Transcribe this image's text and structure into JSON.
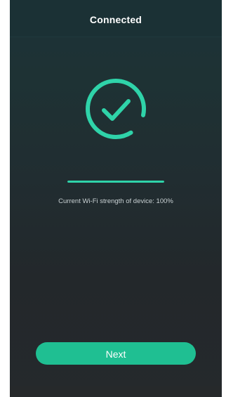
{
  "header": {
    "title": "Connected"
  },
  "status": {
    "icon": "check-circle-icon",
    "wifi_strength_text": "Current Wi-Fi strength of device: 100%",
    "progress": 1.0
  },
  "actions": {
    "next_label": "Next"
  },
  "colors": {
    "accent": "#2fd3a9",
    "button": "#1fbf92",
    "background_top": "#1c3338",
    "background_bottom": "#25292c"
  }
}
